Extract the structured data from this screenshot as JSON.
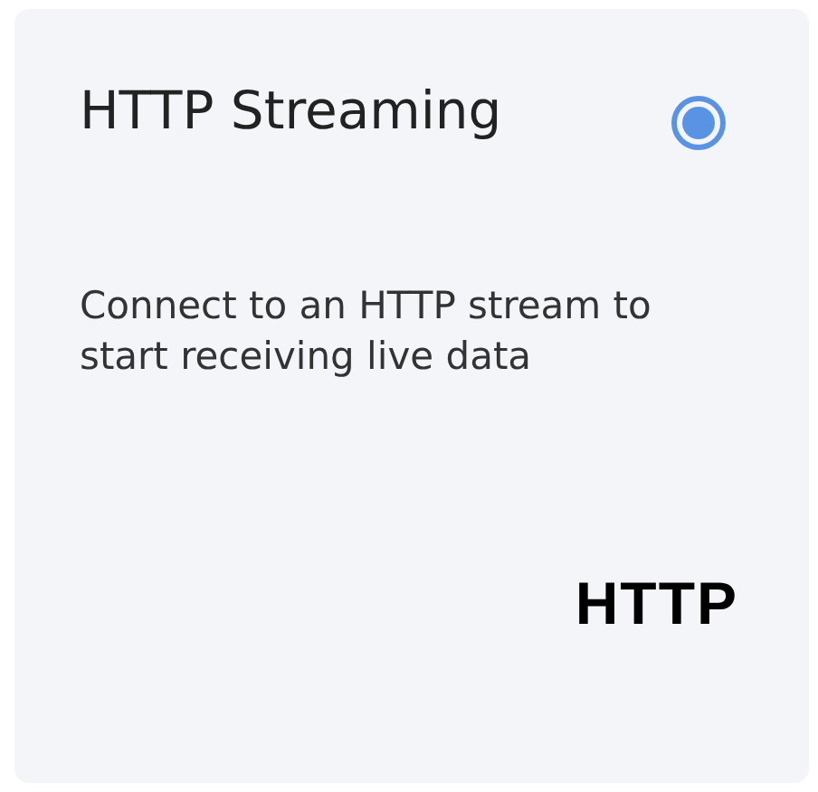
{
  "card": {
    "title": "HTTP Streaming",
    "selected": true,
    "description": "Connect to an HTTP stream to start receiving live data",
    "logo_text": "HTTP"
  }
}
